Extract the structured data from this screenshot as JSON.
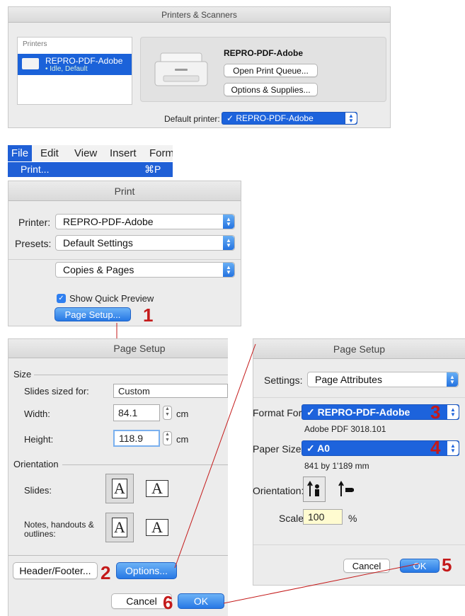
{
  "printers_scanners": {
    "title": "Printers & Scanners",
    "printers_label": "Printers",
    "printer_name": "REPRO-PDF-Adobe",
    "printer_status": "• Idle, Default",
    "detail_name": "REPRO-PDF-Adobe",
    "open_queue": "Open Print Queue...",
    "options_supplies": "Options & Supplies...",
    "default_printer_label": "Default printer:",
    "default_printer_value": "✓ REPRO-PDF-Adobe"
  },
  "menu": {
    "items": [
      "File",
      "Edit",
      "View",
      "Insert",
      "Form"
    ],
    "print_item": "Print...",
    "print_shortcut": "⌘P"
  },
  "print_dialog": {
    "title": "Print",
    "printer_label": "Printer:",
    "printer_value": "REPRO-PDF-Adobe",
    "presets_label": "Presets:",
    "presets_value": "Default Settings",
    "section_value": "Copies & Pages",
    "show_preview": "Show Quick Preview",
    "page_setup_button": "Page Setup..."
  },
  "page_setup_left": {
    "title": "Page Setup",
    "size_heading": "Size",
    "slides_sized_label": "Slides sized for:",
    "slides_sized_value": "Custom",
    "width_label": "Width:",
    "width_value": "84.1",
    "height_label": "Height:",
    "height_value": "118.9",
    "unit": "cm",
    "orientation_heading": "Orientation",
    "slides_label": "Slides:",
    "notes_label": "Notes, handouts & outlines:",
    "orient_glyph": "A",
    "header_footer": "Header/Footer...",
    "options": "Options...",
    "cancel": "Cancel",
    "ok": "OK"
  },
  "page_setup_right": {
    "title": "Page Setup",
    "settings_label": "Settings:",
    "settings_value": "Page Attributes",
    "format_label": "Format For:",
    "format_value": "✓ REPRO-PDF-Adobe",
    "format_sub": "Adobe PDF 3018.101",
    "paper_label": "Paper Size:",
    "paper_value": "✓ A0",
    "paper_sub": "841 by 1'189 mm",
    "orientation_label": "Orientation:",
    "scale_label": "Scale:",
    "scale_value": "100",
    "scale_unit": "%",
    "cancel": "Cancel",
    "ok": "OK"
  },
  "callouts": [
    "1",
    "2",
    "3",
    "4",
    "5",
    "6"
  ],
  "colors": {
    "accent_blue": "#1d63dc",
    "callout_red": "#c41a1a"
  }
}
